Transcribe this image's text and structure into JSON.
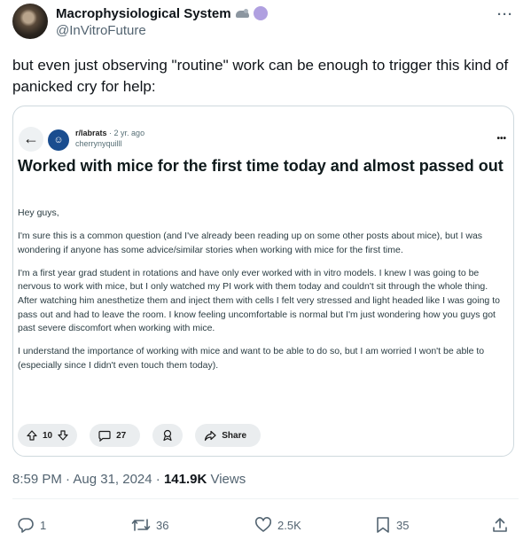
{
  "author": {
    "display_name": "Macrophysiological System",
    "handle": "@InVitroFuture",
    "emoji_icons": [
      "mouse-icon",
      "purple-circle-icon"
    ]
  },
  "tweet": {
    "text": "but even just observing \"routine\" work can be enough to trigger this kind of panicked cry for help:",
    "more_icon": "more-horizontal-icon"
  },
  "embed": {
    "subreddit": "r/labrats",
    "time": "· 2 yr. ago",
    "user": "cherrynyquilll",
    "title": "Worked with mice for the first time today and almost passed out",
    "paragraphs": [
      "Hey guys,",
      "I'm sure this is a common question (and I've already been reading up on some other posts about mice), but I was wondering if anyone has some advice/similar stories when working with mice for the first time.",
      "I'm a first year grad student in rotations and have only ever worked with in vitro models. I knew I was going to be nervous to work with mice, but I only watched my PI work with them today and couldn't sit through the whole thing. After watching him anesthetize them and inject them with cells I felt very stressed and light headed like I was going to pass out and had to leave the room. I know feeling uncomfortable is normal but I'm just wondering how you guys got past severe discomfort when working with mice.",
      "I understand the importance of working with mice and want to be able to do so, but I am worried I won't be able to (especially since I didn't even touch them today)."
    ],
    "votes": "10",
    "comments": "27",
    "share_label": "Share"
  },
  "meta": {
    "timestamp": "8:59 PM · Aug 31, 2024 · ",
    "views_count": "141.9K",
    "views_label": " Views"
  },
  "stats": {
    "replies": "1",
    "reposts": "36",
    "likes": "2.5K",
    "bookmarks": "35"
  }
}
